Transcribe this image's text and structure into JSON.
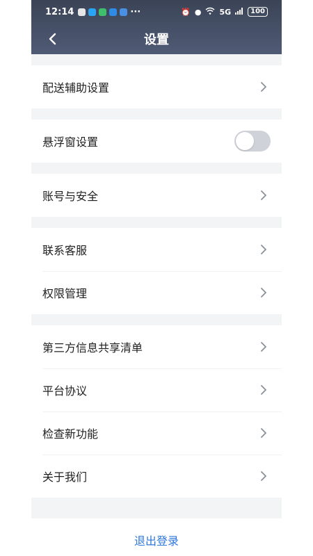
{
  "status_bar": {
    "time": "12:14",
    "more": "···",
    "network": "5G",
    "battery": "100"
  },
  "header": {
    "title": "设置"
  },
  "groups": [
    {
      "items": [
        {
          "label": "配送辅助设置",
          "type": "chevron"
        }
      ]
    },
    {
      "items": [
        {
          "label": "悬浮窗设置",
          "type": "toggle",
          "enabled": false
        }
      ]
    },
    {
      "items": [
        {
          "label": "账号与安全",
          "type": "chevron"
        }
      ]
    },
    {
      "items": [
        {
          "label": "联系客服",
          "type": "chevron"
        },
        {
          "label": "权限管理",
          "type": "chevron"
        }
      ]
    },
    {
      "items": [
        {
          "label": "第三方信息共享清单",
          "type": "chevron"
        },
        {
          "label": "平台协议",
          "type": "chevron"
        },
        {
          "label": "检查新功能",
          "type": "chevron"
        },
        {
          "label": "关于我们",
          "type": "chevron"
        }
      ]
    }
  ],
  "logout_label": "退出登录",
  "colors": {
    "header_top": "#3b4456",
    "header_bottom": "#4f5a75",
    "accent": "#2f76d9",
    "toggle_off": "#cfd2d8"
  }
}
